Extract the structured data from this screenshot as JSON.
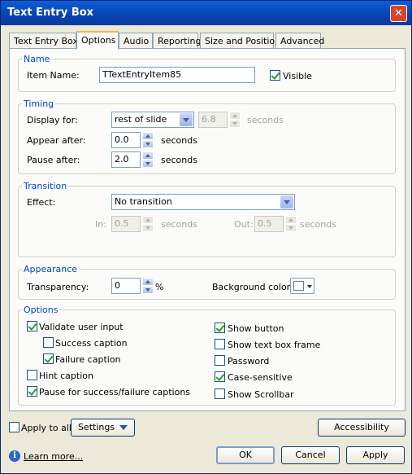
{
  "window": {
    "title": "Text Entry Box",
    "close_glyph": "✕"
  },
  "tabs": [
    "Text Entry Box",
    "Options",
    "Audio",
    "Reporting",
    "Size and Position",
    "Advanced"
  ],
  "active_tab": "Options",
  "name_group": {
    "label": "Name",
    "item_name_label": "Item Name:",
    "item_name_value": "TTextEntryItem85",
    "visible_label": "Visible",
    "visible_checked": true
  },
  "timing": {
    "label": "Timing",
    "display_for_label": "Display for:",
    "display_for_value": "rest of slide",
    "display_seconds_value": "6.8",
    "display_seconds_unit": "seconds",
    "appear_after_label": "Appear after:",
    "appear_after_value": "0.0",
    "appear_unit": "seconds",
    "pause_after_label": "Pause after:",
    "pause_after_value": "2.0",
    "pause_unit": "seconds"
  },
  "transition": {
    "label": "Transition",
    "effect_label": "Effect:",
    "effect_value": "No transition",
    "in_label": "In:",
    "in_value": "0.5",
    "in_unit": "seconds",
    "out_label": "Out:",
    "out_value": "0.5",
    "out_unit": "seconds"
  },
  "appearance": {
    "label": "Appearance",
    "transparency_label": "Transparency:",
    "transparency_value": "0",
    "transparency_unit": "%",
    "bg_color_label": "Background color:",
    "bg_color": "#ffffff"
  },
  "options": {
    "label": "Options",
    "validate_user_input": "Validate user input",
    "success_caption": "Success caption",
    "failure_caption": "Failure caption",
    "hint_caption": "Hint caption",
    "pause_for_captions": "Pause for success/failure captions",
    "show_button": "Show button",
    "show_text_box_frame": "Show text box frame",
    "password": "Password",
    "case_sensitive": "Case-sensitive",
    "show_scrollbar": "Show Scrollbar",
    "checked": {
      "validate_user_input": true,
      "success_caption": false,
      "failure_caption": true,
      "hint_caption": false,
      "pause_for_captions": true,
      "show_button": true,
      "show_text_box_frame": false,
      "password": false,
      "case_sensitive": true,
      "show_scrollbar": false
    }
  },
  "bottom": {
    "apply_to_all": "Apply to all",
    "apply_to_all_checked": false,
    "settings": "Settings",
    "accessibility": "Accessibility",
    "learn_more": "Learn more...",
    "ok": "OK",
    "cancel": "Cancel",
    "apply": "Apply"
  }
}
